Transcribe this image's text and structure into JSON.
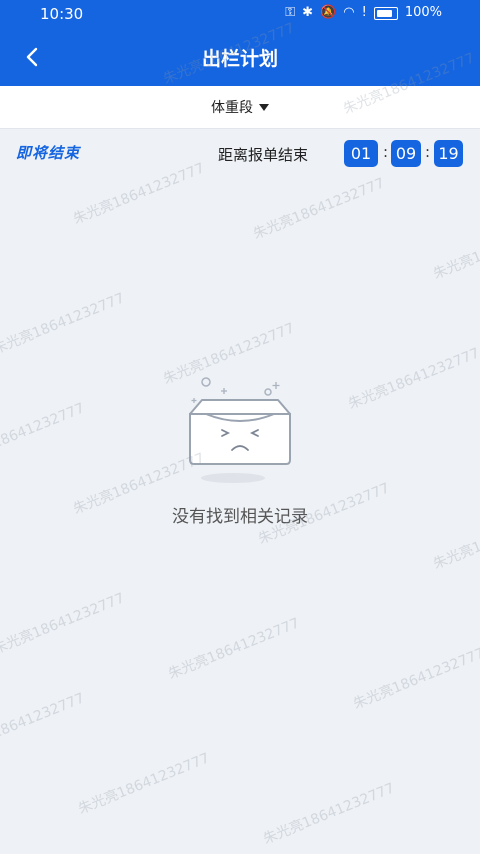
{
  "status_bar": {
    "time": "10:30",
    "battery": "100%"
  },
  "header": {
    "title": "出栏计划"
  },
  "filter": {
    "label": "体重段"
  },
  "countdown": {
    "badge": "即将结束",
    "label": "距离报单结束",
    "hours": "01",
    "minutes": "09",
    "seconds": "19",
    "sep1": ":",
    "sep2": ":"
  },
  "empty": {
    "message": "没有找到相关记录"
  },
  "watermark": {
    "text": "朱光亮18641232777"
  },
  "colors": {
    "primary": "#1565e0",
    "background": "#eef1f5"
  }
}
